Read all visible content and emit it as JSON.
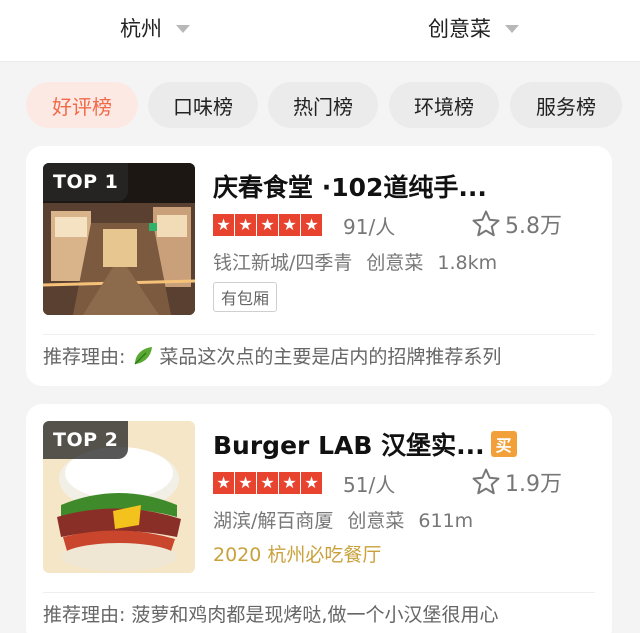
{
  "filters": {
    "city": "杭州",
    "cuisine": "创意菜"
  },
  "tabs": [
    "好评榜",
    "口味榜",
    "热门榜",
    "环境榜",
    "服务榜"
  ],
  "restaurants": [
    {
      "rank": "TOP 1",
      "name": "庆春食堂 ·102道纯手...",
      "stars": 5,
      "price": "91/人",
      "favorites": "5.8万",
      "area": "钱江新城/四季青",
      "category": "创意菜",
      "distance": "1.8km",
      "tag": "有包厢",
      "reason_label": "推荐理由:",
      "reason": "菜品这次点的主要是店内的招牌推荐系列"
    },
    {
      "rank": "TOP 2",
      "name": "Burger LAB 汉堡实...",
      "buy_badge": "买",
      "stars": 5,
      "price": "51/人",
      "favorites": "1.9万",
      "area": "湖滨/解百商厦",
      "category": "创意菜",
      "distance": "611m",
      "award": "2020 杭州必吃餐厅",
      "reason_label": "推荐理由:",
      "reason": "菠萝和鸡肉都是现烤哒,做一个小汉堡很用心"
    }
  ],
  "colors": {
    "accent": "#f06a4a",
    "active_tab_bg": "#fde9e3",
    "star_red": "#e8432f",
    "award_gold": "#c9a23c",
    "buy_orange": "#f2a13a"
  },
  "icons": [
    "dropdown-triangle-icon",
    "star-rating-icon",
    "favorite-star-icon",
    "leaf-icon"
  ]
}
